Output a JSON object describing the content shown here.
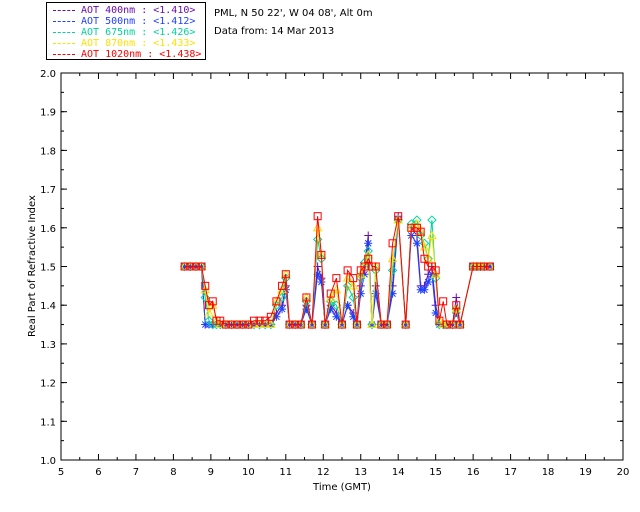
{
  "header": {
    "site": "PML, N 50 22', W 04 08', Alt 0m",
    "date": "Data from: 14 Mar 2013"
  },
  "legend": [
    {
      "label": "AOT  400nm : <1.410>",
      "color": "#6a0dad"
    },
    {
      "label": "AOT  500nm : <1.412>",
      "color": "#1f3fff"
    },
    {
      "label": "AOT  675nm : <1.426>",
      "color": "#00d49c"
    },
    {
      "label": "AOT  870nm : <1.433>",
      "color": "#ffe000"
    },
    {
      "label": "AOT 1020nm : <1.438>",
      "color": "#ff0000"
    }
  ],
  "chart_data": {
    "type": "line",
    "xlabel": "Time (GMT)",
    "ylabel": "Real Part of Refractive Index",
    "xlim": [
      5,
      20
    ],
    "ylim": [
      1.0,
      2.0
    ],
    "xticks": [
      "5",
      "6",
      "7",
      "8",
      "9",
      "10",
      "11",
      "12",
      "13",
      "14",
      "15",
      "16",
      "17",
      "18",
      "19",
      "20"
    ],
    "yticks": [
      "1.0",
      "1.1",
      "1.2",
      "1.3",
      "1.4",
      "1.5",
      "1.6",
      "1.7",
      "1.8",
      "1.9",
      "2.0"
    ],
    "x": [
      8.3,
      8.45,
      8.6,
      8.75,
      8.85,
      8.95,
      9.05,
      9.15,
      9.25,
      9.4,
      9.55,
      9.7,
      9.85,
      10.0,
      10.15,
      10.3,
      10.45,
      10.6,
      10.75,
      10.9,
      11.0,
      11.1,
      11.25,
      11.4,
      11.55,
      11.7,
      11.85,
      11.95,
      12.05,
      12.2,
      12.35,
      12.5,
      12.65,
      12.8,
      12.9,
      13.0,
      13.1,
      13.2,
      13.3,
      13.4,
      13.55,
      13.7,
      13.85,
      14.0,
      14.2,
      14.35,
      14.5,
      14.6,
      14.7,
      14.8,
      14.9,
      15.0,
      15.1,
      15.2,
      15.3,
      15.45,
      15.55,
      15.65,
      16.0,
      16.1,
      16.2,
      16.3,
      16.45
    ],
    "series": [
      {
        "name": "AOT  400nm : <1.410>",
        "marker": "plus",
        "values": [
          1.5,
          1.5,
          1.5,
          1.5,
          1.35,
          1.35,
          1.35,
          1.35,
          1.35,
          1.35,
          1.35,
          1.35,
          1.35,
          1.35,
          1.35,
          1.35,
          1.35,
          1.35,
          1.38,
          1.4,
          1.45,
          1.35,
          1.35,
          1.35,
          1.4,
          1.35,
          1.5,
          1.47,
          1.35,
          1.4,
          1.38,
          1.35,
          1.4,
          1.38,
          1.35,
          1.45,
          1.5,
          1.58,
          1.35,
          1.45,
          1.35,
          1.35,
          1.45,
          1.63,
          1.35,
          1.6,
          1.58,
          1.45,
          1.45,
          1.48,
          1.5,
          1.4,
          1.35,
          1.35,
          1.35,
          1.35,
          1.42,
          1.35,
          1.5,
          1.5,
          1.5,
          1.5,
          1.5
        ]
      },
      {
        "name": "AOT  500nm : <1.412>",
        "marker": "star",
        "values": [
          1.5,
          1.5,
          1.5,
          1.5,
          1.35,
          1.35,
          1.35,
          1.35,
          1.35,
          1.35,
          1.35,
          1.35,
          1.35,
          1.35,
          1.35,
          1.35,
          1.35,
          1.35,
          1.37,
          1.39,
          1.44,
          1.35,
          1.35,
          1.35,
          1.39,
          1.35,
          1.48,
          1.46,
          1.35,
          1.39,
          1.37,
          1.35,
          1.4,
          1.37,
          1.35,
          1.43,
          1.48,
          1.56,
          1.35,
          1.43,
          1.35,
          1.35,
          1.43,
          1.62,
          1.35,
          1.58,
          1.56,
          1.44,
          1.44,
          1.46,
          1.48,
          1.38,
          1.35,
          1.35,
          1.35,
          1.35,
          1.38,
          1.35,
          1.5,
          1.5,
          1.5,
          1.5,
          1.5
        ]
      },
      {
        "name": "AOT  675nm : <1.426>",
        "marker": "diamond",
        "values": [
          1.5,
          1.5,
          1.5,
          1.5,
          1.42,
          1.36,
          1.35,
          1.35,
          1.35,
          1.35,
          1.35,
          1.35,
          1.35,
          1.35,
          1.35,
          1.35,
          1.35,
          1.35,
          1.4,
          1.42,
          1.47,
          1.35,
          1.35,
          1.35,
          1.41,
          1.35,
          1.57,
          1.52,
          1.35,
          1.41,
          1.4,
          1.35,
          1.45,
          1.42,
          1.35,
          1.47,
          1.51,
          1.54,
          1.35,
          1.49,
          1.35,
          1.35,
          1.49,
          1.62,
          1.35,
          1.61,
          1.62,
          1.58,
          1.56,
          1.52,
          1.62,
          1.47,
          1.35,
          1.35,
          1.35,
          1.35,
          1.39,
          1.35,
          1.5,
          1.5,
          1.5,
          1.5,
          1.5
        ]
      },
      {
        "name": "AOT  870nm : <1.433>",
        "marker": "triangle",
        "values": [
          1.5,
          1.5,
          1.5,
          1.5,
          1.44,
          1.38,
          1.4,
          1.36,
          1.35,
          1.35,
          1.35,
          1.35,
          1.35,
          1.35,
          1.35,
          1.35,
          1.35,
          1.35,
          1.41,
          1.44,
          1.48,
          1.35,
          1.35,
          1.35,
          1.42,
          1.35,
          1.6,
          1.53,
          1.35,
          1.42,
          1.44,
          1.35,
          1.47,
          1.45,
          1.35,
          1.48,
          1.5,
          1.53,
          1.35,
          1.5,
          1.35,
          1.35,
          1.52,
          1.62,
          1.35,
          1.6,
          1.61,
          1.59,
          1.55,
          1.52,
          1.58,
          1.48,
          1.36,
          1.35,
          1.35,
          1.35,
          1.39,
          1.35,
          1.5,
          1.5,
          1.5,
          1.5,
          1.5
        ]
      },
      {
        "name": "AOT 1020nm : <1.438>",
        "marker": "square",
        "values": [
          1.5,
          1.5,
          1.5,
          1.5,
          1.45,
          1.4,
          1.41,
          1.36,
          1.36,
          1.35,
          1.35,
          1.35,
          1.35,
          1.35,
          1.36,
          1.36,
          1.36,
          1.37,
          1.41,
          1.45,
          1.48,
          1.35,
          1.35,
          1.35,
          1.42,
          1.35,
          1.63,
          1.53,
          1.35,
          1.43,
          1.47,
          1.35,
          1.49,
          1.47,
          1.35,
          1.49,
          1.5,
          1.52,
          1.5,
          1.5,
          1.35,
          1.35,
          1.56,
          1.63,
          1.35,
          1.6,
          1.6,
          1.59,
          1.52,
          1.5,
          1.5,
          1.49,
          1.36,
          1.41,
          1.35,
          1.35,
          1.4,
          1.35,
          1.5,
          1.5,
          1.5,
          1.5,
          1.5
        ]
      }
    ]
  }
}
